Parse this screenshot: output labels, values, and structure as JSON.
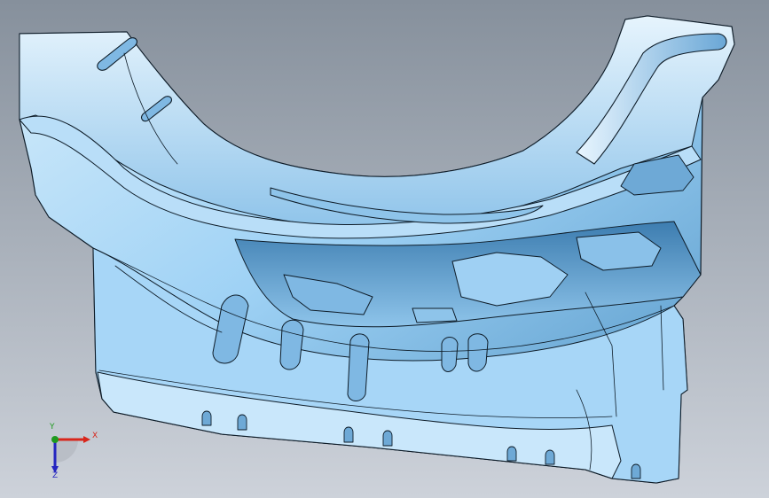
{
  "viewport": {
    "background_top": "#86909c",
    "background_bottom": "#cdd2da"
  },
  "part": {
    "fill_light": "#d4ecfb",
    "fill_mid": "#9fd2f5",
    "fill_dark": "#4c90c2",
    "edge_color": "#0e1c28"
  },
  "triad": {
    "x_label": "X",
    "y_label": "Y",
    "z_label": "Z",
    "x_color": "#d8261b",
    "y_color": "#1f9a1f",
    "z_color": "#2424c0"
  }
}
